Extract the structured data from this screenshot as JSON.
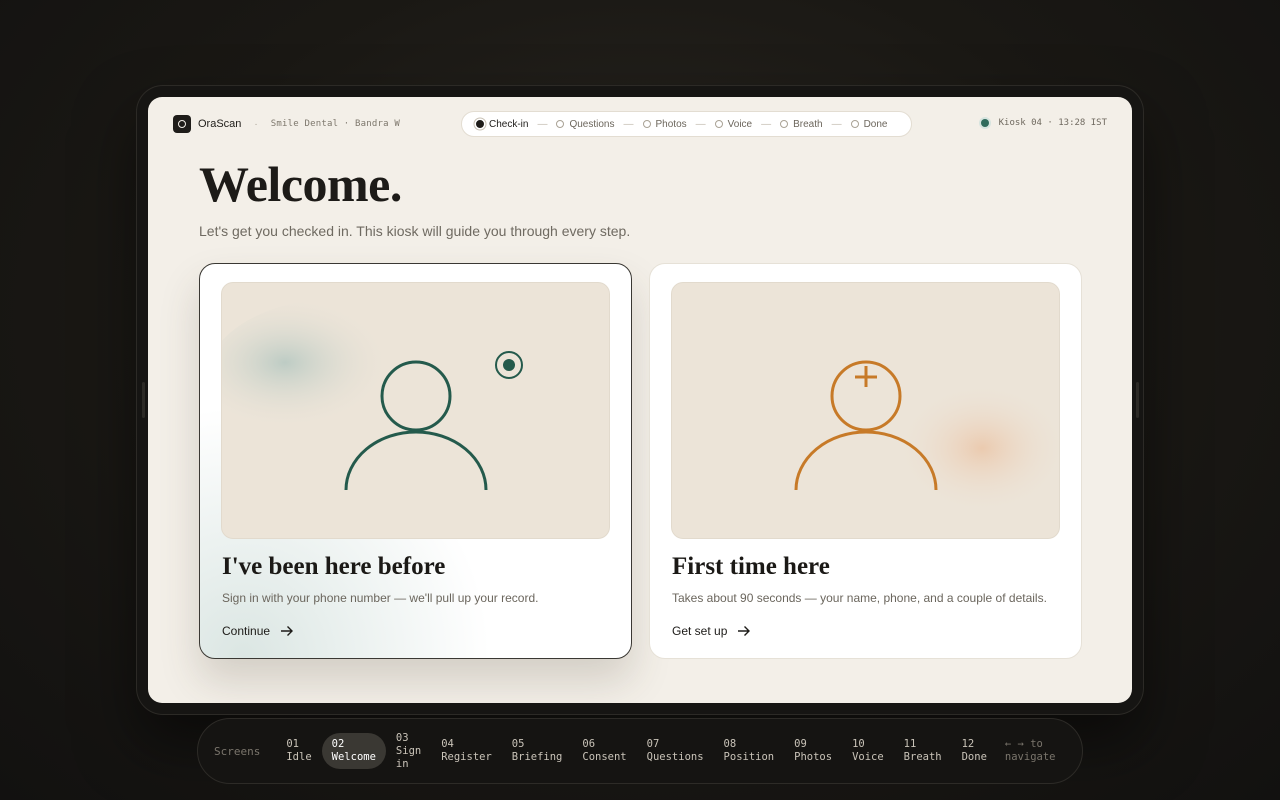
{
  "header": {
    "brand": "OraScan",
    "separator": "·",
    "clinic": "Smile Dental · Bandra W",
    "kiosk": "Kiosk 04 · 13:28 IST"
  },
  "stepper": {
    "steps": [
      "Check-in",
      "Questions",
      "Photos",
      "Voice",
      "Breath",
      "Done"
    ],
    "active": "Check-in"
  },
  "main": {
    "title": "Welcome.",
    "subtitle": "Let's get you checked in. This kiosk will guide you through every step."
  },
  "cards": {
    "returning": {
      "title": "I've been here before",
      "description": "Sign in with your phone number — we'll pull up your record.",
      "cta": "Continue",
      "icon": "user-icon",
      "accent": "#245a4c"
    },
    "new": {
      "title": "First time here",
      "description": "Takes about 90 seconds — your name, phone, and a couple of details.",
      "cta": "Get set up",
      "icon": "user-plus-icon",
      "accent": "#c77a28"
    }
  },
  "nav": {
    "label": "Screens",
    "items": [
      "01\nIdle",
      "02\nWelcome",
      "03\nSign\nin",
      "04\nRegister",
      "05\nBriefing",
      "06\nConsent",
      "07\nQuestions",
      "08\nPosition",
      "09\nPhotos",
      "10\nVoice",
      "11\nBreath",
      "12\nDone"
    ],
    "active_index": 1,
    "hint": "← → to\nnavigate"
  }
}
